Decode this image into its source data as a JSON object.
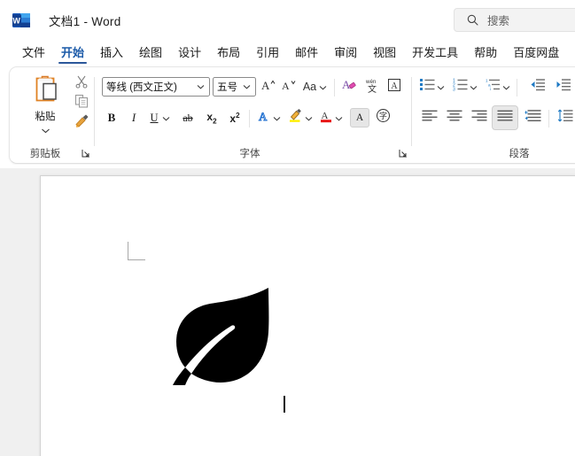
{
  "titlebar": {
    "app_icon": "word-icon",
    "document_title": "文档1  -  Word",
    "search": {
      "icon": "search-icon",
      "placeholder": "搜索",
      "value": ""
    }
  },
  "ribbon": {
    "tabs": [
      {
        "label": "文件",
        "active": false
      },
      {
        "label": "开始",
        "active": true
      },
      {
        "label": "插入",
        "active": false
      },
      {
        "label": "绘图",
        "active": false
      },
      {
        "label": "设计",
        "active": false
      },
      {
        "label": "布局",
        "active": false
      },
      {
        "label": "引用",
        "active": false
      },
      {
        "label": "邮件",
        "active": false
      },
      {
        "label": "审阅",
        "active": false
      },
      {
        "label": "视图",
        "active": false
      },
      {
        "label": "开发工具",
        "active": false
      },
      {
        "label": "帮助",
        "active": false
      },
      {
        "label": "百度网盘",
        "active": false
      }
    ],
    "groups": {
      "clipboard": {
        "label": "剪贴板",
        "paste": {
          "label": "粘贴",
          "icon": "paste-clipboard-icon",
          "caret": "chevron-down-icon"
        },
        "cut": {
          "icon": "scissors-icon",
          "tooltip": "剪切"
        },
        "copy": {
          "icon": "copy-icon",
          "tooltip": "复制"
        },
        "format_painter": {
          "icon": "format-painter-icon",
          "tooltip": "格式刷"
        },
        "dialog_launcher": "dialog-launcher-icon"
      },
      "font": {
        "label": "字体",
        "font_name": {
          "value": "等线 (西文正文)",
          "caret": "chevron-down-icon"
        },
        "font_size": {
          "value": "五号",
          "caret": "chevron-down-icon"
        },
        "grow_font": {
          "icon": "increase-font-size-icon",
          "glyph": "A"
        },
        "shrink_font": {
          "icon": "decrease-font-size-icon",
          "glyph": "A"
        },
        "change_case": {
          "icon": "change-case-icon",
          "glyph": "Aa",
          "caret": "chevron-down-icon"
        },
        "clear_formatting": {
          "icon": "clear-formatting-icon"
        },
        "phonetic_guide": {
          "icon": "phonetic-guide-icon",
          "glyph": "wén"
        },
        "character_border": {
          "icon": "character-border-icon",
          "glyph": "A"
        },
        "bold": {
          "icon": "bold-icon",
          "glyph": "B"
        },
        "italic": {
          "icon": "italic-icon",
          "glyph": "I"
        },
        "underline": {
          "icon": "underline-icon",
          "glyph": "U",
          "caret": "chevron-down-icon"
        },
        "strikethrough": {
          "icon": "strikethrough-icon",
          "glyph": "ab"
        },
        "subscript": {
          "icon": "subscript-icon",
          "glyph": "x",
          "sub": "2"
        },
        "superscript": {
          "icon": "superscript-icon",
          "glyph": "x",
          "sup": "2"
        },
        "text_effects": {
          "icon": "text-effects-icon",
          "glyph": "A",
          "caret": "chevron-down-icon",
          "color": "#1f6fd0"
        },
        "text_highlight": {
          "icon": "highlight-color-icon",
          "caret": "chevron-down-icon",
          "color": "#ffee00"
        },
        "font_color": {
          "icon": "font-color-icon",
          "glyph": "A",
          "caret": "chevron-down-icon",
          "color": "#e81313"
        },
        "character_shading": {
          "icon": "character-shading-icon",
          "glyph": "A"
        },
        "enclose_characters": {
          "icon": "enclose-characters-icon"
        },
        "dialog_launcher": "dialog-launcher-icon"
      },
      "paragraph": {
        "label": "段落",
        "bullets": {
          "icon": "bullet-list-icon",
          "caret": "chevron-down-icon"
        },
        "numbering": {
          "icon": "numbered-list-icon",
          "caret": "chevron-down-icon"
        },
        "multilevel": {
          "icon": "multilevel-list-icon",
          "caret": "chevron-down-icon"
        },
        "decrease_indent": {
          "icon": "decrease-indent-icon"
        },
        "increase_indent": {
          "icon": "increase-indent-icon"
        },
        "align_left": {
          "icon": "align-left-icon",
          "active": false
        },
        "align_center": {
          "icon": "align-center-icon",
          "active": false
        },
        "align_right": {
          "icon": "align-right-icon",
          "active": false
        },
        "justify": {
          "icon": "justify-icon",
          "active": true
        },
        "distribute": {
          "icon": "distributed-align-icon",
          "active": false
        },
        "line_spacing": {
          "icon": "line-spacing-icon",
          "caret": "chevron-down-icon"
        }
      }
    }
  },
  "document": {
    "page_background": "#ffffff",
    "canvas_background": "#f0f0f0",
    "margin_marker": "margin-corner-marker",
    "content": {
      "leaf_graphic": {
        "icon": "leaf-icon",
        "color": "#000000"
      },
      "text_cursor": {
        "icon": "text-caret",
        "visible": true
      }
    }
  },
  "colors": {
    "accent": "#2b579a",
    "ribbon_bg": "#ffffff",
    "canvas": "#f0f0f0",
    "text": "#1b1b1b"
  }
}
